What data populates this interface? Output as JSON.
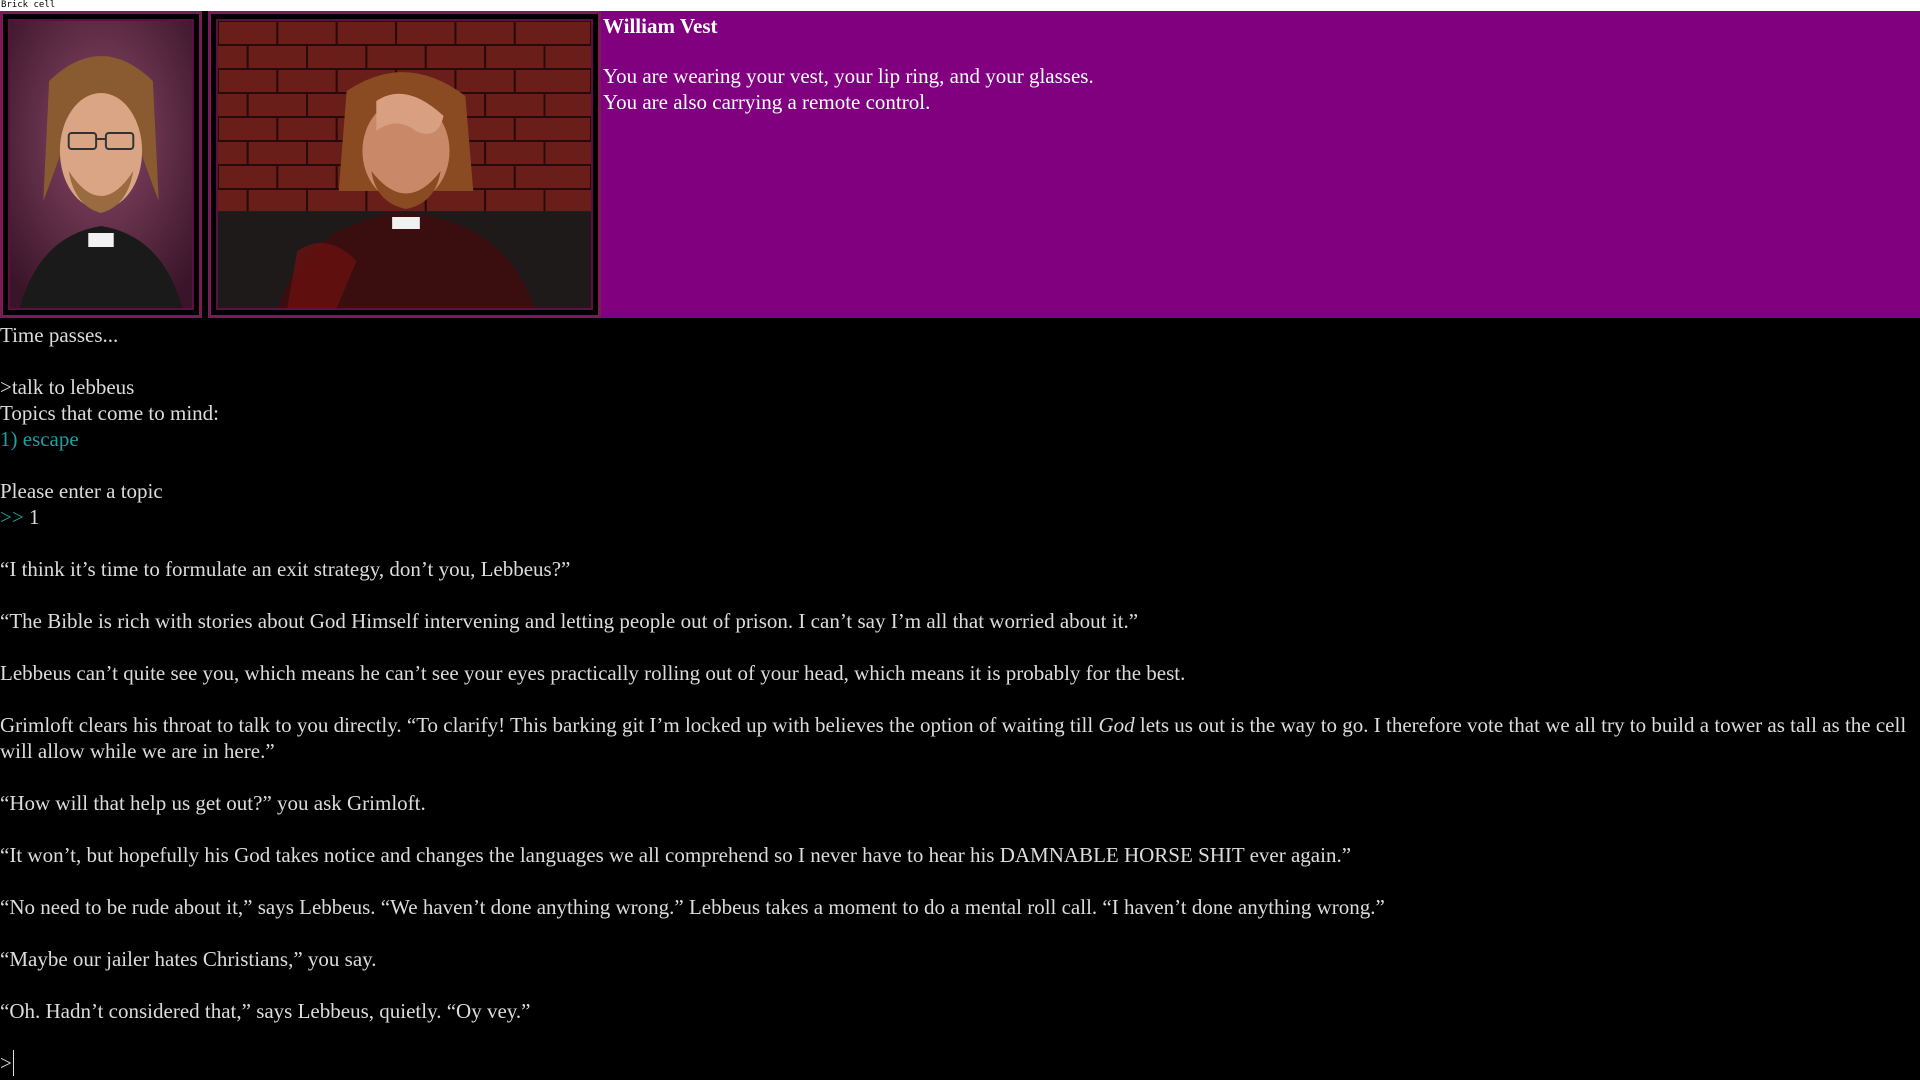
{
  "window": {
    "title": "Brick cell"
  },
  "character": {
    "name": "William Vest",
    "description_line1": "You are wearing your vest, your lip ring, and your glasses.",
    "description_line2": "You are also carrying a remote control."
  },
  "colors": {
    "info_panel_bg": "#800080",
    "frame_border": "#7c1a55",
    "teal_text": "#1fa0a0",
    "body_text": "#dcdcdc"
  },
  "transcript": {
    "time_passes": "Time passes...",
    "command": ">talk to lebbeus",
    "topics_header": "Topics that come to mind:",
    "topic_1": "1) escape",
    "enter_topic": "Please enter a topic",
    "topic_prompt": ">>",
    "topic_input": " 1",
    "line_1": "“I think it’s time to formulate an exit strategy, don’t you, Lebbeus?”",
    "line_2": "“The Bible is rich with stories about God Himself intervening and letting people out of prison. I can’t say I’m all that worried about it.”",
    "line_3": "Lebbeus can’t quite see you, which means he can’t see your eyes practically rolling out of your head, which means it is probably for the best.",
    "line_4a": "Grimloft clears his throat to talk to you directly. “To clarify! This barking git I’m locked up with believes the option of waiting till ",
    "line_4b": "God",
    "line_4c": " lets us out is the way to go. I therefore vote that we all try to build a tower as tall as the cell will allow while we are in here.”",
    "line_5": "“How will that help us get out?” you ask Grimloft.",
    "line_6": "“It won’t, but hopefully his God takes notice and changes the languages we all comprehend so I never have to hear his DAMNABLE HORSE SHIT ever again.”",
    "line_7": "“No need to be rude about it,” says Lebbeus. “We haven’t done anything wrong.” Lebbeus takes a moment to do a mental roll call. “I haven’t done anything wrong.”",
    "line_8": "“Maybe our jailer hates Christians,” you say.",
    "line_9": "“Oh. Hadn’t considered that,” says Lebbeus, quietly. “Oy vey.”"
  },
  "input": {
    "prompt": ">"
  }
}
